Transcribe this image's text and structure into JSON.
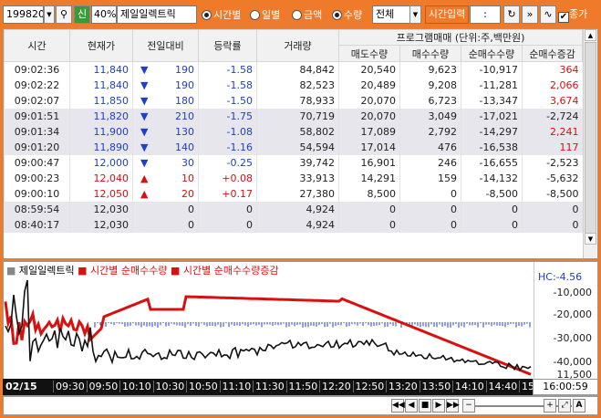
{
  "toolbar": {
    "code": "199820",
    "badge": "신",
    "pct": "40%",
    "name": "제일일렉트릭",
    "r_period": "시간별",
    "r_daily": "일별",
    "r_amount": "금액",
    "r_qty": "수량",
    "select": "전체",
    "time_btn": "시간입력",
    "time_val": ":",
    "chk": "종가"
  },
  "table": {
    "headers": {
      "time": "시간",
      "price": "현재가",
      "prev": "전일대비",
      "rate": "등락률",
      "vol": "거래량",
      "prog": "프로그램매매 (단위:주,백만원)",
      "sell": "매도수량",
      "buy": "매수수량",
      "net": "순매수수량",
      "netchg": "순매수증감"
    },
    "rows": [
      {
        "time": "09:02:36",
        "price": "11,840",
        "dir": "down",
        "prev": "190",
        "rate": "-1.58",
        "vol": "84,842",
        "sell": "20,540",
        "buy": "9,623",
        "net": "-10,917",
        "netchg": "364",
        "g": false
      },
      {
        "time": "09:02:22",
        "price": "11,840",
        "dir": "down",
        "prev": "190",
        "rate": "-1.58",
        "vol": "82,523",
        "sell": "20,489",
        "buy": "9,208",
        "net": "-11,281",
        "netchg": "2,066",
        "g": false
      },
      {
        "time": "09:02:07",
        "price": "11,850",
        "dir": "down",
        "prev": "180",
        "rate": "-1.50",
        "vol": "78,933",
        "sell": "20,070",
        "buy": "6,723",
        "net": "-13,347",
        "netchg": "3,674",
        "g": false
      },
      {
        "time": "09:01:51",
        "price": "11,820",
        "dir": "down",
        "prev": "210",
        "rate": "-1.75",
        "vol": "70,719",
        "sell": "20,070",
        "buy": "3,049",
        "net": "-17,021",
        "netchg": "-2,724",
        "g": true
      },
      {
        "time": "09:01:34",
        "price": "11,900",
        "dir": "down",
        "prev": "130",
        "rate": "-1.08",
        "vol": "58,802",
        "sell": "17,089",
        "buy": "2,792",
        "net": "-14,297",
        "netchg": "2,241",
        "g": true
      },
      {
        "time": "09:01:20",
        "price": "11,890",
        "dir": "down",
        "prev": "140",
        "rate": "-1.16",
        "vol": "54,594",
        "sell": "17,014",
        "buy": "476",
        "net": "-16,538",
        "netchg": "117",
        "g": true
      },
      {
        "time": "09:00:47",
        "price": "12,000",
        "dir": "down",
        "prev": "30",
        "rate": "-0.25",
        "vol": "39,742",
        "sell": "16,901",
        "buy": "246",
        "net": "-16,655",
        "netchg": "-2,523",
        "g": false
      },
      {
        "time": "09:00:23",
        "price": "12,040",
        "dir": "up",
        "prev": "10",
        "rate": "+0.08",
        "vol": "33,913",
        "sell": "14,291",
        "buy": "159",
        "net": "-14,132",
        "netchg": "-5,632",
        "g": false
      },
      {
        "time": "09:00:10",
        "price": "12,050",
        "dir": "up",
        "prev": "20",
        "rate": "+0.17",
        "vol": "27,380",
        "sell": "8,500",
        "buy": "0",
        "net": "-8,500",
        "netchg": "-8,500",
        "g": false
      },
      {
        "time": "08:59:54",
        "price": "12,030",
        "dir": "none",
        "prev": "0",
        "rate": "0",
        "vol": "4,924",
        "sell": "0",
        "buy": "0",
        "net": "0",
        "netchg": "0",
        "g": true
      },
      {
        "time": "08:40:17",
        "price": "12,030",
        "dir": "none",
        "prev": "0",
        "rate": "0",
        "vol": "4,924",
        "sell": "0",
        "buy": "0",
        "net": "0",
        "netchg": "0",
        "g": true
      }
    ]
  },
  "chart": {
    "legend1": "제일일렉트릭",
    "legend2": "시간별 순매수수량",
    "legend3": "시간별 순매수수량증감",
    "hc": "HC:-4.56",
    "yaxis": [
      "-10,000",
      "-20,000",
      "-30,000",
      "-40,000"
    ],
    "ybottom": "11,500",
    "xdate": "02/15",
    "xticks": [
      "09:30",
      "09:50",
      "10:10",
      "10:30",
      "10:50",
      "11:10",
      "11:30",
      "11:50",
      "12:20",
      "12:50",
      "13:20",
      "13:50",
      "14:10",
      "14:40",
      "15:00"
    ],
    "xend": "16:00:59",
    "colors": {
      "price": "#111111",
      "net": "#d81010",
      "chg": "#1f3fc6"
    }
  }
}
